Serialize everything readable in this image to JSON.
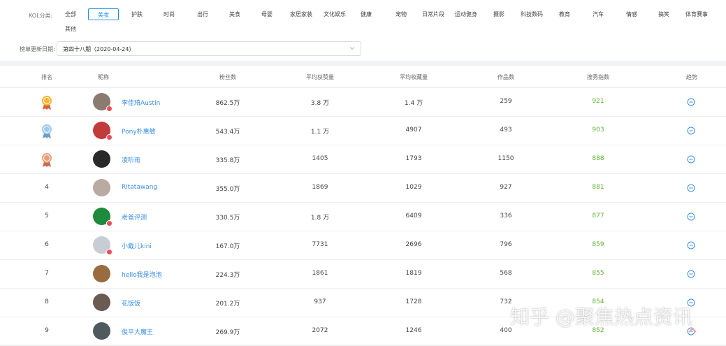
{
  "filters": {
    "category_label": "KOL分类:",
    "categories": [
      "全部",
      "美妆",
      "护肤",
      "时尚",
      "出行",
      "美食",
      "母婴",
      "家居家装",
      "文化娱乐",
      "健康",
      "宠物",
      "日常片段",
      "运动健身",
      "摄影",
      "科技数码",
      "教育",
      "汽车",
      "情感",
      "搞笑",
      "体育赛事",
      "其他"
    ],
    "active_category": "美妆",
    "date_label": "榜单更新日期:",
    "date_value": "第四十八期（2020-04-24）"
  },
  "table": {
    "headers": [
      "排名",
      "昵称",
      "粉丝数",
      "平均获赞量",
      "平均收藏量",
      "作品数",
      "搜秀指数",
      "趋势"
    ],
    "rows": [
      {
        "rank": "1",
        "medal": "gold",
        "nickname": "李佳琦Austin",
        "fans": "862.5万",
        "avg_likes": "3.8 万",
        "avg_fav": "1.4 万",
        "works": "259",
        "index": "921",
        "avatar_color": "#8a7a70",
        "verified": true
      },
      {
        "rank": "2",
        "medal": "silver",
        "nickname": "Pony朴惠敏",
        "fans": "543.4万",
        "avg_likes": "1.1 万",
        "avg_fav": "4907",
        "works": "493",
        "index": "903",
        "avatar_color": "#c23b3b",
        "verified": true
      },
      {
        "rank": "3",
        "medal": "bronze",
        "nickname": "凌听雨",
        "fans": "335.8万",
        "avg_likes": "1405",
        "avg_fav": "1793",
        "works": "1150",
        "index": "888",
        "avatar_color": "#2a2a2a",
        "verified": false
      },
      {
        "rank": "4",
        "medal": "",
        "nickname": "Ritatawang",
        "fans": "355.0万",
        "avg_likes": "1869",
        "avg_fav": "1029",
        "works": "927",
        "index": "881",
        "avatar_color": "#b9aaa2",
        "verified": false
      },
      {
        "rank": "5",
        "medal": "",
        "nickname": "老爸评测",
        "fans": "330.5万",
        "avg_likes": "1.8 万",
        "avg_fav": "6409",
        "works": "336",
        "index": "877",
        "avatar_color": "#1e8a3c",
        "verified": true
      },
      {
        "rank": "6",
        "medal": "",
        "nickname": "小戴儿kini",
        "fans": "167.0万",
        "avg_likes": "7731",
        "avg_fav": "2696",
        "works": "796",
        "index": "859",
        "avatar_color": "#c8cdd3",
        "verified": true
      },
      {
        "rank": "7",
        "medal": "",
        "nickname": "hello我是泡泡",
        "fans": "224.3万",
        "avg_likes": "1861",
        "avg_fav": "1819",
        "works": "568",
        "index": "855",
        "avatar_color": "#9a6b3f",
        "verified": false
      },
      {
        "rank": "8",
        "medal": "",
        "nickname": "花饭饭",
        "fans": "201.2万",
        "avg_likes": "937",
        "avg_fav": "1728",
        "works": "732",
        "index": "854",
        "avatar_color": "#6b5b52",
        "verified": false
      },
      {
        "rank": "9",
        "medal": "",
        "nickname": "俊平大魔王",
        "fans": "269.9万",
        "avg_likes": "2072",
        "avg_fav": "1246",
        "works": "400",
        "index": "852",
        "avatar_color": "#4f5a5f",
        "verified": false
      }
    ]
  },
  "watermark": "知乎 @聚焦热点资讯",
  "colors": {
    "accent": "#1e90e8",
    "link": "#3a8ee6",
    "index_green": "#5fb336",
    "verified_red": "#f04b5a"
  },
  "icons": {
    "trend": "trend-circle-icon",
    "dropdown": "chevron-down-icon",
    "back_to_top": "chevron-up-icon"
  }
}
